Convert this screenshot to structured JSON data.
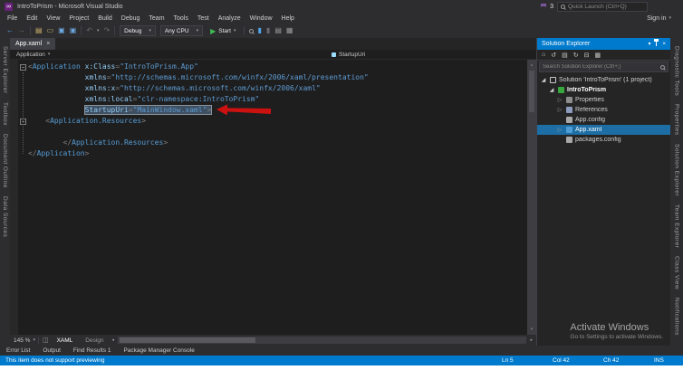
{
  "window": {
    "title": "IntroToPrism - Microsoft Visual Studio",
    "notification_count": "3",
    "quick_launch_placeholder": "Quick Launch (Ctrl+Q)",
    "sign_in": "Sign in"
  },
  "menu": {
    "items": [
      "File",
      "Edit",
      "View",
      "Project",
      "Build",
      "Debug",
      "Team",
      "Tools",
      "Test",
      "Analyze",
      "Window",
      "Help"
    ]
  },
  "toolbar": {
    "debug_target": "Debug",
    "platform": "Any CPU",
    "start_label": "Start"
  },
  "doc_tab": {
    "label": "App.xaml"
  },
  "breadcrumb": {
    "type_name": "Application",
    "member_name": "StartupUri"
  },
  "left_strip": {
    "tabs": [
      "Server Explorer",
      "Toolbox",
      "Document Outline",
      "Data Sources"
    ]
  },
  "right_strip": {
    "tabs": [
      "Diagnostic Tools",
      "Properties",
      "Solution Explorer",
      "Team Explorer",
      "Class View",
      "Notifications"
    ]
  },
  "editor": {
    "zoom": "145 %",
    "view_tabs": {
      "xaml": "XAML",
      "design": "Design"
    },
    "lines": [
      {
        "fold": true,
        "indent": 0,
        "segments": [
          {
            "t": "<",
            "c": "d"
          },
          {
            "t": "Application",
            "c": "t"
          },
          {
            "t": " ",
            "c": "p"
          },
          {
            "t": "x:Class",
            "c": "a"
          },
          {
            "t": "=",
            "c": "d"
          },
          {
            "t": "\"IntroToPrism.App\"",
            "c": "s"
          }
        ]
      },
      {
        "indent": 13,
        "segments": [
          {
            "t": "xmlns",
            "c": "a"
          },
          {
            "t": "=",
            "c": "d"
          },
          {
            "t": "\"http://schemas.microsoft.com/winfx/2006/xaml/presentation\"",
            "c": "s"
          }
        ]
      },
      {
        "indent": 13,
        "segments": [
          {
            "t": "xmlns:x",
            "c": "a"
          },
          {
            "t": "=",
            "c": "d"
          },
          {
            "t": "\"http://schemas.microsoft.com/winfx/2006/xaml\"",
            "c": "s"
          }
        ]
      },
      {
        "indent": 13,
        "segments": [
          {
            "t": "xmlns:local",
            "c": "a"
          },
          {
            "t": "=",
            "c": "d"
          },
          {
            "t": "\"clr-namespace:IntroToPrism\"",
            "c": "s"
          }
        ]
      },
      {
        "indent": 13,
        "highlight": true,
        "segments": [
          {
            "t": "StartupUri",
            "c": "a"
          },
          {
            "t": "=",
            "c": "d"
          },
          {
            "t": "\"MainWindow.xaml\"",
            "c": "s"
          },
          {
            "t": ">",
            "c": "d"
          }
        ]
      },
      {
        "fold": true,
        "indent": 4,
        "segments": [
          {
            "t": "<",
            "c": "d"
          },
          {
            "t": "Application.Resources",
            "c": "t"
          },
          {
            "t": ">",
            "c": "d"
          }
        ]
      },
      {
        "indent": 0,
        "segments": []
      },
      {
        "indent": 8,
        "segments": [
          {
            "t": "</",
            "c": "d"
          },
          {
            "t": "Application.Resources",
            "c": "t"
          },
          {
            "t": ">",
            "c": "d"
          }
        ]
      },
      {
        "indent": 0,
        "segments": [
          {
            "t": "</",
            "c": "d"
          },
          {
            "t": "Application",
            "c": "t"
          },
          {
            "t": ">",
            "c": "d"
          }
        ]
      }
    ]
  },
  "solution_explorer": {
    "title": "Solution Explorer",
    "search_placeholder": "Search Solution Explorer (Ctrl+;)",
    "tree": [
      {
        "indent": 0,
        "expander": "expanded",
        "icon": "solution-icon",
        "label": "Solution 'IntroToPrism' (1 project)"
      },
      {
        "indent": 1,
        "expander": "expanded",
        "icon": "csharp-project-icon",
        "label": "IntroToPrism",
        "bold": true
      },
      {
        "indent": 2,
        "expander": "collapsed",
        "icon": "properties-icon",
        "label": "Properties"
      },
      {
        "indent": 2,
        "expander": "collapsed",
        "icon": "references-icon",
        "label": "References"
      },
      {
        "indent": 2,
        "icon": "config-file-icon",
        "label": "App.config"
      },
      {
        "indent": 2,
        "expander": "collapsed",
        "icon": "xaml-file-icon",
        "label": "App.xaml",
        "selected": true
      },
      {
        "indent": 2,
        "icon": "config-file-icon",
        "label": "packages.config"
      }
    ]
  },
  "panel_tabs": [
    "Error List",
    "Output",
    "Find Results 1",
    "Package Manager Console"
  ],
  "status_bar": {
    "message": "This item does not support previewing",
    "line": "Ln 5",
    "column": "Col 42",
    "character": "Ch 42",
    "mode": "INS"
  },
  "watermark": {
    "title": "Activate Windows",
    "subtitle": "Go to Settings to activate Windows."
  },
  "icons": {
    "back": "←",
    "forward": "→",
    "new_file": "▤",
    "open_folder": "▭",
    "save": "▣",
    "save_all": "▣",
    "undo": "↶",
    "redo": "↷",
    "dropdown": "▾",
    "start": "▶",
    "close": "×",
    "home": "⌂",
    "sync": "↺",
    "show_all_files": "▤",
    "refresh": "↻",
    "collapse_all": "⊟",
    "view_grid": "▦",
    "split": "◫",
    "scroll_up": "▴",
    "scroll_down": "▾",
    "scroll_left": "◂",
    "scroll_right": "▸",
    "minus": "−",
    "bookmark": "▮",
    "expanded": "◢",
    "collapsed": "▷",
    "infinity": "∞"
  },
  "colors": {
    "accent": "#007acc",
    "selection": "#1c6ea4",
    "arrow": "#cc1111",
    "highlight_bg": "#3e4f61",
    "start_green": "#3fba54"
  }
}
